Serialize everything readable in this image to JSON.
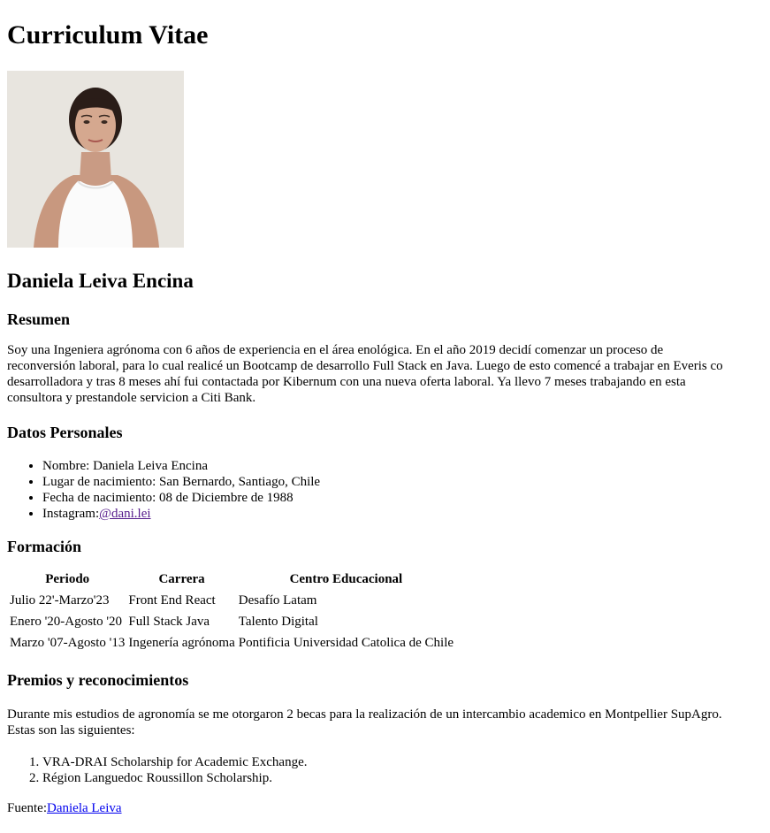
{
  "page": {
    "title": "Curriculum Vitae"
  },
  "profile": {
    "name": "Daniela Leiva Encina",
    "photo_alt": "Daniela Leiva Encina"
  },
  "summary": {
    "heading": "Resumen",
    "lines": [
      "Soy una Ingeniera agrónoma con 6 años de experiencia en el área enológica. En el año 2019 decidí comenzar un proceso de",
      "reconversión laboral, para lo cual realicé un Bootcamp de desarrollo Full Stack en Java. Luego de esto comencé a trabajar en Everis co",
      "desarrolladora y tras 8 meses ahí fui contactada por Kibernum con una nueva oferta laboral. Ya llevo 7 meses trabajando en esta",
      "consultora y prestandole servicion a Citi Bank."
    ]
  },
  "personal": {
    "heading": "Datos Personales",
    "name_item": "Nombre: Daniela Leiva Encina",
    "birthplace_item": "Lugar de nacimiento: San Bernardo, Santiago, Chile",
    "birthdate_item": "Fecha de nacimiento: 08 de Diciembre de 1988",
    "instagram_label": "Instagram:",
    "instagram_link": "@dani.lei"
  },
  "education": {
    "heading": "Formación",
    "columns": [
      "Periodo",
      "Carrera",
      "Centro Educacional"
    ],
    "rows": [
      [
        "Julio 22'-Marzo'23",
        "Front End React",
        "Desafío Latam"
      ],
      [
        "Enero '20-Agosto '20",
        "Full Stack Java",
        "Talento Digital"
      ],
      [
        "Marzo '07-Agosto '13",
        "Ingenería agrónoma",
        "Pontificia Universidad Catolica de Chile"
      ]
    ]
  },
  "awards": {
    "heading": "Premios y reconocimientos",
    "intro_line1": "Durante mis estudios de agronomía se me otorgaron 2 becas para la realización de un intercambio academico en Montpellier SupAgro.",
    "intro_line2": "Estas son las siguientes:",
    "items": [
      "VRA-DRAI Scholarship for Academic Exchange.",
      "Région Languedoc Roussillon Scholarship."
    ]
  },
  "footer": {
    "source_label": "Fuente:",
    "source_link": "Daniela Leiva"
  },
  "colors": {
    "link": "#0000ee",
    "visited_link": "#551a8b",
    "text": "#000000",
    "background": "#ffffff"
  }
}
